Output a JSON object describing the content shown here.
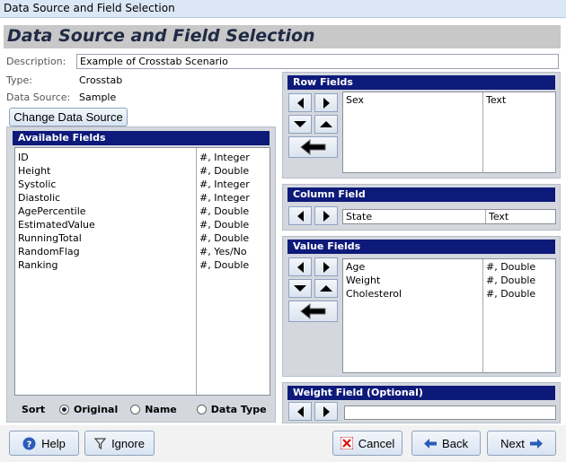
{
  "window": {
    "title": "Data Source and Field Selection"
  },
  "banner": {
    "title": "Data Source and Field Selection"
  },
  "description": {
    "label": "Description:",
    "value": "Example of Crosstab Scenario"
  },
  "type": {
    "label": "Type:",
    "value": "Crosstab"
  },
  "data_source": {
    "label": "Data Source:",
    "value": "Sample"
  },
  "change_button": {
    "label": "Change Data Source"
  },
  "available": {
    "header": "Available Fields",
    "items": [
      {
        "name": "ID",
        "type": "#, Integer"
      },
      {
        "name": "Height",
        "type": "#, Double"
      },
      {
        "name": "Systolic",
        "type": "#, Integer"
      },
      {
        "name": "Diastolic",
        "type": "#, Integer"
      },
      {
        "name": "AgePercentile",
        "type": "#, Double"
      },
      {
        "name": "EstimatedValue",
        "type": "#, Double"
      },
      {
        "name": "RunningTotal",
        "type": "#, Double"
      },
      {
        "name": "RandomFlag",
        "type": "#, Yes/No"
      },
      {
        "name": "Ranking",
        "type": "#, Double"
      }
    ]
  },
  "sort": {
    "label": "Sort",
    "options": [
      "Original",
      "Name",
      "Data Type"
    ],
    "selected": "Original"
  },
  "row_fields": {
    "header": "Row Fields",
    "items": [
      {
        "name": "Sex",
        "type": "Text"
      }
    ]
  },
  "column_field": {
    "header": "Column Field",
    "items": [
      {
        "name": "State",
        "type": "Text"
      }
    ]
  },
  "value_fields": {
    "header": "Value Fields",
    "items": [
      {
        "name": "Age",
        "type": "#, Double"
      },
      {
        "name": "Weight",
        "type": "#, Double"
      },
      {
        "name": "Cholesterol",
        "type": "#, Double"
      }
    ]
  },
  "weight_field": {
    "header": "Weight Field (Optional)",
    "value": ""
  },
  "footer": {
    "help": "Help",
    "ignore": "Ignore",
    "cancel": "Cancel",
    "back": "Back",
    "next": "Next"
  },
  "colors": {
    "panel_header": "#0e1a7a",
    "panel_bg": "#d4d8de",
    "banner_bg": "#c8c8c8"
  }
}
